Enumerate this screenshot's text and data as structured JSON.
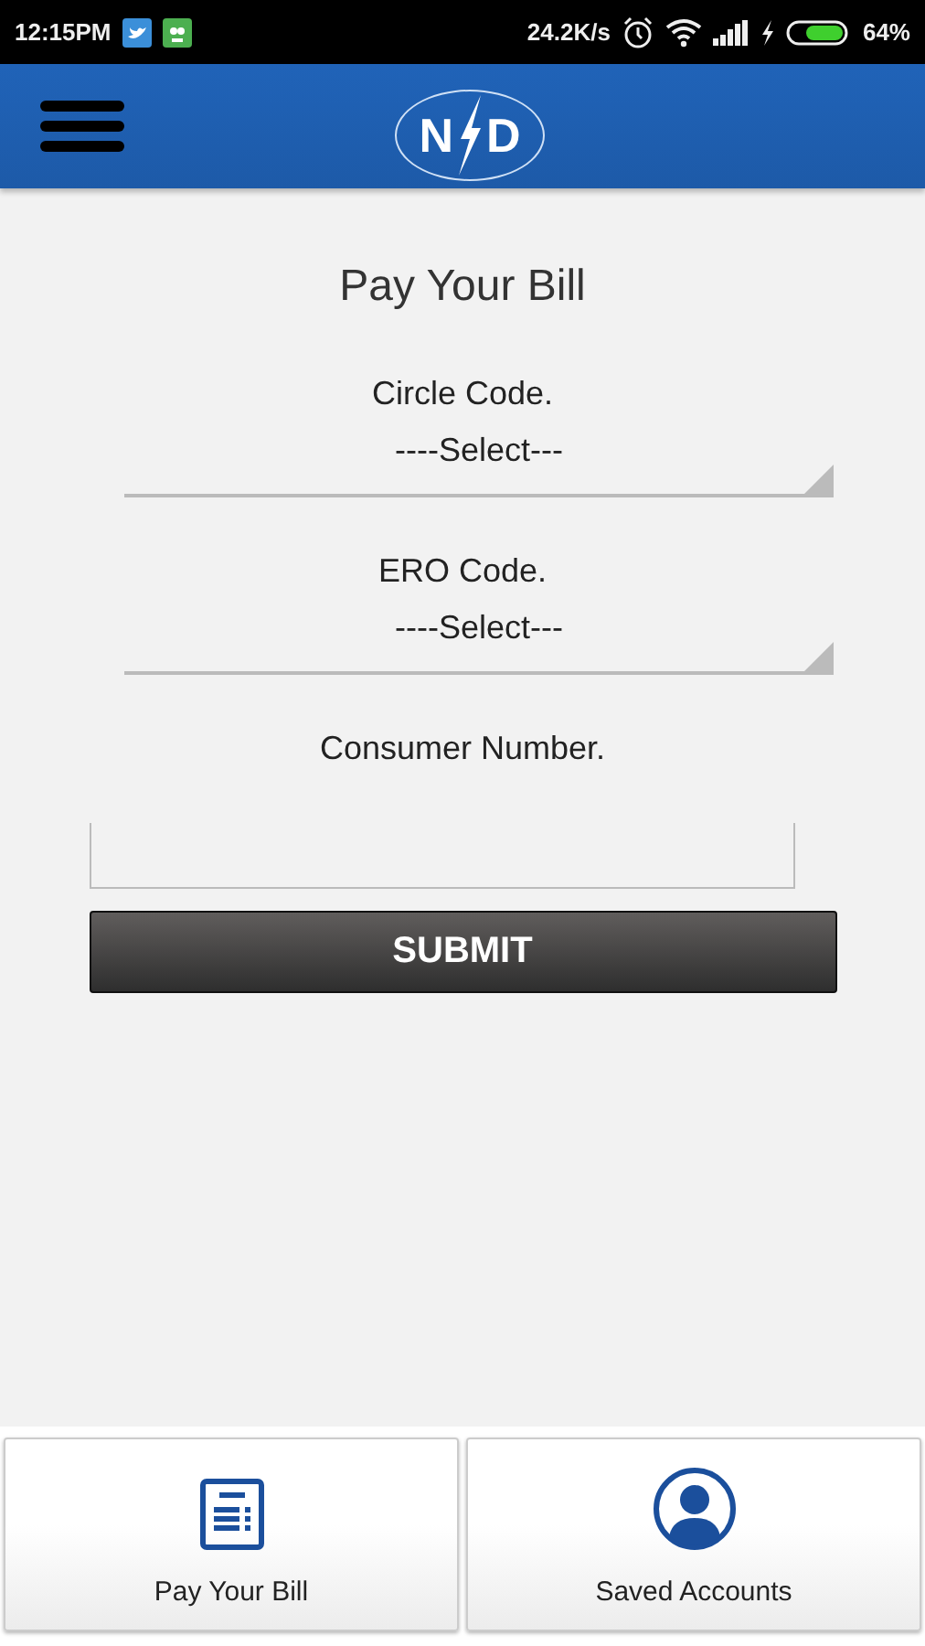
{
  "status_bar": {
    "time": "12:15PM",
    "speed": "24.2K/s",
    "battery": "64%"
  },
  "header": {
    "logo_left": "N",
    "logo_right": "D"
  },
  "title": "Pay Your Bill",
  "fields": [
    {
      "kind": "select",
      "label": "Circle Code.",
      "value": "----Select---"
    },
    {
      "kind": "select",
      "label": "ERO Code.",
      "value": "----Select---"
    },
    {
      "kind": "text",
      "label": "Consumer Number."
    }
  ],
  "submit": "SUBMIT",
  "bottom_nav": [
    {
      "kind": "bill",
      "label": "Pay Your Bill"
    },
    {
      "kind": "account",
      "label": "Saved Accounts"
    }
  ]
}
